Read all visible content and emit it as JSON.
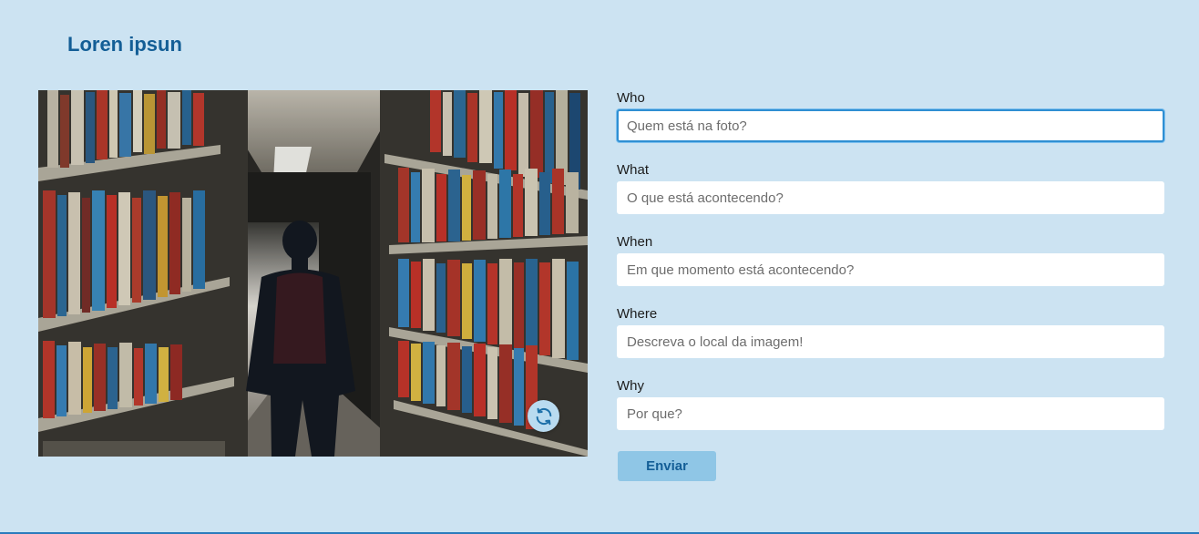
{
  "header": {
    "title": "Loren ipsun"
  },
  "photo": {
    "alt_icon": "library-photo",
    "refresh_icon": "refresh-icon"
  },
  "form": {
    "fields": [
      {
        "label": "Who",
        "placeholder": "Quem está na foto?",
        "focused": true
      },
      {
        "label": "What",
        "placeholder": "O que está acontecendo?"
      },
      {
        "label": "When",
        "placeholder": "Em que momento está acontecendo?"
      },
      {
        "label": "Where",
        "placeholder": "Descreva o local da imagem!"
      },
      {
        "label": "Why",
        "placeholder": "Por que?"
      }
    ],
    "submit_label": "Enviar"
  },
  "colors": {
    "background": "#cce3f2",
    "brand": "#135e96",
    "button": "#8fc6e6",
    "focus": "#2f8fd3"
  }
}
